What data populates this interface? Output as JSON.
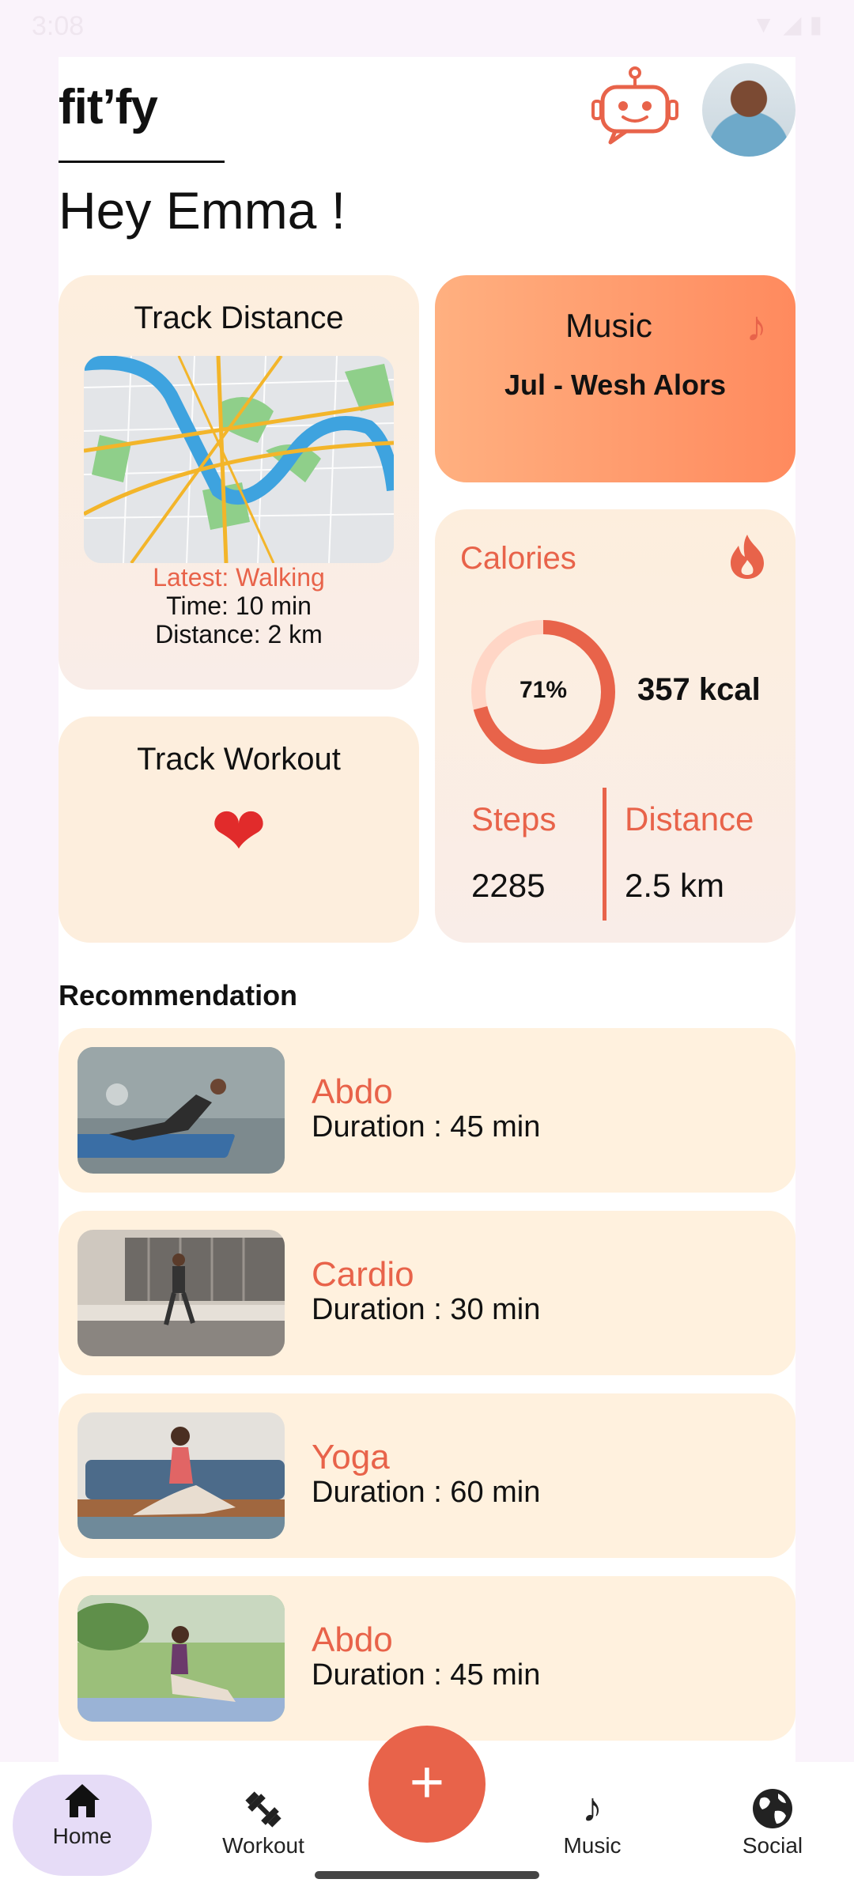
{
  "status_bar": {
    "time": "3:08"
  },
  "header": {
    "logo": "fit’fy",
    "greeting": "Hey Emma !"
  },
  "track_distance": {
    "title": "Track Distance",
    "latest": "Latest: Walking",
    "time": "Time: 10 min",
    "distance": "Distance: 2 km"
  },
  "music": {
    "title": "Music",
    "song": "Jul - Wesh Alors"
  },
  "track_workout": {
    "title": "Track Workout"
  },
  "calories": {
    "title": "Calories",
    "percent_label": "71%",
    "progress": 0.71,
    "kcal": "357 kcal",
    "steps_label": "Steps",
    "steps_value": "2285",
    "distance_label": "Distance",
    "distance_value": "2.5 km"
  },
  "recommendation": {
    "title": "Recommendation",
    "items": [
      {
        "name": "Abdo",
        "duration": "Duration : 45 min"
      },
      {
        "name": "Cardio",
        "duration": "Duration : 30 min"
      },
      {
        "name": "Yoga",
        "duration": "Duration : 60 min"
      },
      {
        "name": "Abdo",
        "duration": "Duration : 45 min"
      }
    ]
  },
  "nav": {
    "home": "Home",
    "workout": "Workout",
    "add": "+",
    "music": "Music",
    "social": "Social"
  },
  "colors": {
    "accent": "#e8634a",
    "card": "#fdeedd",
    "nav_active": "#e6dcf7"
  }
}
